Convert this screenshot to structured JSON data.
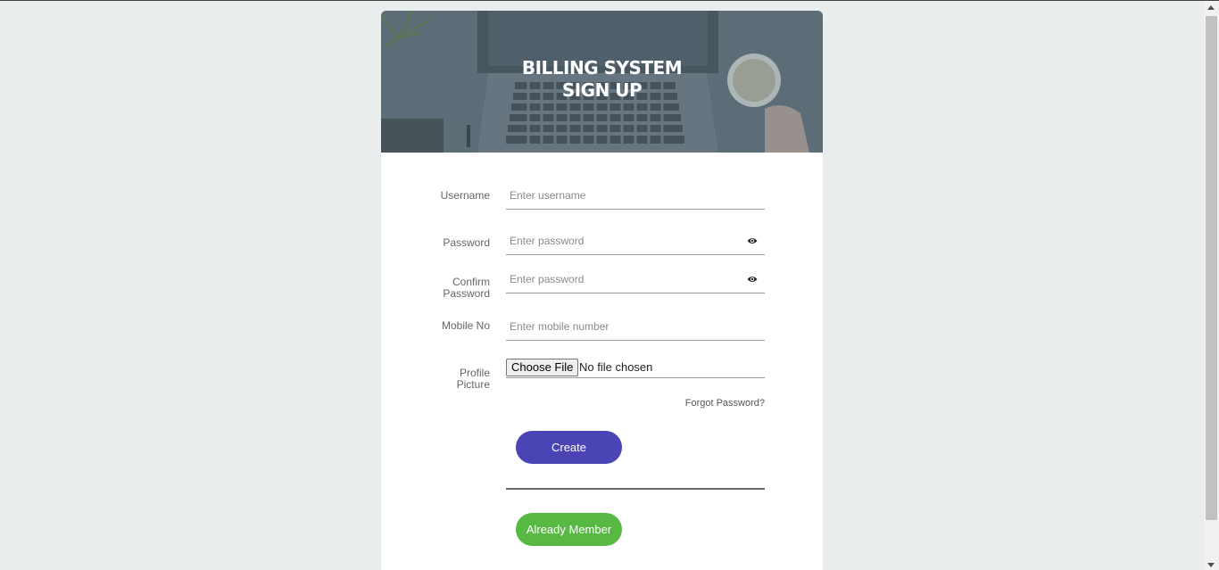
{
  "header": {
    "title_line1": "BILLING SYSTEM",
    "title_line2": "SIGN UP"
  },
  "form": {
    "username": {
      "label": "Username",
      "placeholder": "Enter username",
      "value": ""
    },
    "password": {
      "label": "Password",
      "placeholder": "Enter password",
      "value": ""
    },
    "confirm_password": {
      "label_line1": "Confirm",
      "label_line2": "Password",
      "placeholder": "Enter password",
      "value": ""
    },
    "mobile": {
      "label": "Mobile No",
      "placeholder": "Enter mobile number",
      "value": ""
    },
    "profile_picture": {
      "label_line1": "Profile",
      "label_line2": "Picture",
      "button_label": "Choose File",
      "status": "No file chosen"
    },
    "forgot_link": "Forgot Password?",
    "create_label": "Create",
    "member_label": "Already Member"
  },
  "colors": {
    "create_button": "#4a44b4",
    "member_button": "#58b844",
    "page_background": "#e9edee"
  }
}
